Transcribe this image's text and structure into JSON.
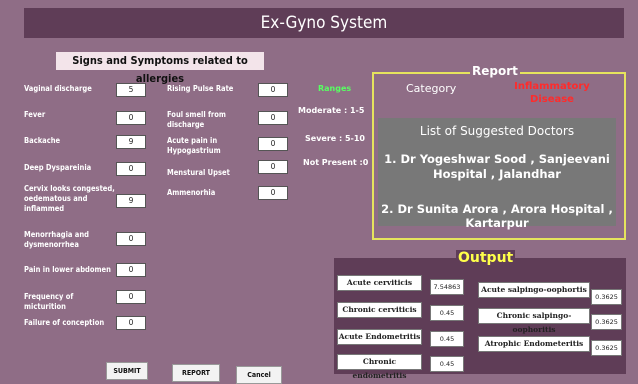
{
  "app": {
    "title": "Ex-Gyno System"
  },
  "symptoms": {
    "section_title": "Signs and Symptoms related to allergies",
    "left": [
      {
        "label": "Vaginal discharge",
        "value": "5"
      },
      {
        "label": "Fever",
        "value": "0"
      },
      {
        "label": "Backache",
        "value": "9"
      },
      {
        "label": "Deep Dyspareinia",
        "value": "0"
      },
      {
        "label": "Cervix looks congested, oedematous and inflammed",
        "value": "9"
      },
      {
        "label": "Menorrhagia and dysmenorrhea",
        "value": "0"
      },
      {
        "label": "Pain in lower abdomen",
        "value": "0"
      },
      {
        "label": "Frequency of micturition",
        "value": "0"
      },
      {
        "label": "Failure of conception",
        "value": "0"
      }
    ],
    "right": [
      {
        "label": "Rising Pulse Rate",
        "value": "0"
      },
      {
        "label": "Foul smell from discharge",
        "value": "0"
      },
      {
        "label": "Acute pain in Hypogastrium",
        "value": "0"
      },
      {
        "label": "Menstural Upset",
        "value": "0"
      },
      {
        "label": "Ammenorhia",
        "value": "0"
      }
    ]
  },
  "ranges": {
    "title": "Ranges",
    "moderate": "Moderate : 1-5",
    "severe": "Severe : 5-10",
    "not_present": "Not Present :0"
  },
  "report": {
    "title": "Report",
    "category_label": "Category",
    "category_value": "Inflammatory Disease",
    "doctors_title": "List of Suggested Doctors",
    "doctor1": "1. Dr Yogeshwar Sood , Sanjeevani Hospital , Jalandhar",
    "doctor2": "2. Dr Sunita Arora , Arora Hospital , Kartarpur"
  },
  "output": {
    "title": "Output",
    "left": [
      {
        "label": "Acute cerviticis",
        "value": "7.54863"
      },
      {
        "label": "Chronic cerviticis",
        "value": "0.45"
      },
      {
        "label": "Acute Endometritis",
        "value": "0.45"
      },
      {
        "label": "Chronic endometritis",
        "value": "0.45"
      }
    ],
    "right": [
      {
        "label": "Acute salpingo-oophortis",
        "value": "0.3625"
      },
      {
        "label": "Chronic salpingo-oophoritis",
        "value": "0.3625"
      },
      {
        "label": "Atrophic Endometeritis",
        "value": "0.3625"
      }
    ]
  },
  "buttons": {
    "submit": "SUBMIT",
    "report": "REPORT",
    "cancel": "Cancel"
  },
  "colors": {
    "background": "#8f6d86",
    "titlebar": "#5f3d57",
    "ranges": "#58ff62",
    "report_border": "#e6e45d",
    "category_value": "#ff2b2b",
    "output_title": "#ffff4a"
  }
}
